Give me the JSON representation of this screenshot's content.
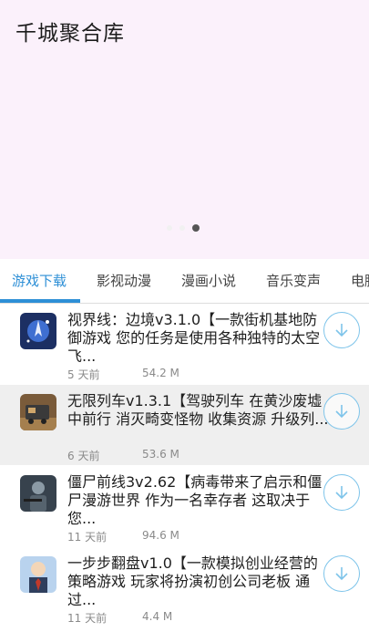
{
  "header": {
    "title": "千城聚合库"
  },
  "banner": {
    "dots": 3,
    "active_dot": 3
  },
  "tabs": [
    {
      "label": "游戏下载",
      "active": true
    },
    {
      "label": "影视动漫",
      "active": false
    },
    {
      "label": "漫画小说",
      "active": false
    },
    {
      "label": "音乐变声",
      "active": false
    },
    {
      "label": "电脑",
      "active": false
    }
  ],
  "items": [
    {
      "title": "视界线：边境v3.1.0【一款街机基地防御游戏 您的任务是使用各种独特的太空飞...",
      "time": "5 天前",
      "size": "54.2 M",
      "icon": "space-game-icon"
    },
    {
      "title": "无限列车v1.3.1【驾驶列车 在黄沙废墟中前行 消灭畸变怪物 收集资源 升级列...",
      "time": "6 天前",
      "size": "53.6 M",
      "icon": "train-game-icon"
    },
    {
      "title": "僵尸前线3v2.62【病毒带来了启示和僵尸漫游世界 作为一名幸存者 这取决于您...",
      "time": "11 天前",
      "size": "94.6 M",
      "icon": "zombie-game-icon"
    },
    {
      "title": "一步步翻盘v1.0【一款模拟创业经营的策略游戏 玩家将扮演初创公司老板 通过...",
      "time": "11 天前",
      "size": "4.4 M",
      "icon": "business-game-icon"
    }
  ],
  "colors": {
    "accent": "#2d8fd6",
    "banner_bg": "#fbf1fb",
    "download_ring": "#7ec4ea"
  }
}
